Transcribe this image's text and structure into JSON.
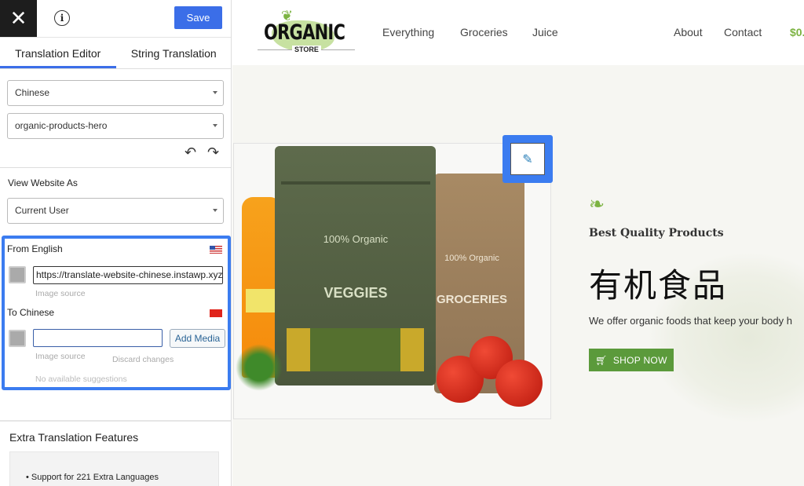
{
  "sidebar": {
    "close_icon": "close-icon",
    "info_icon": "info-icon",
    "info_glyph": "i",
    "save_label": "Save",
    "tabs": [
      {
        "label": "Translation Editor",
        "active": true
      },
      {
        "label": "String Translation",
        "active": false
      }
    ],
    "language_select": "Chinese",
    "string_select": "organic-products-hero",
    "view_as_label": "View Website As",
    "view_as_select": "Current User",
    "from_label": "From English",
    "from_value": "https://translate-website-chinese.instawp.xyz/w",
    "image_source_label": "Image source",
    "to_label": "To Chinese",
    "to_value": "",
    "add_media_label": "Add Media",
    "discard_label": "Discard changes",
    "suggestions_label": "No available suggestions",
    "extra_title": "Extra Translation Features",
    "extra_items": [
      "Support for 221 Extra Languages"
    ]
  },
  "site": {
    "logo_text": "ORGANIC",
    "logo_sub": "STORE",
    "nav": [
      "Everything",
      "Groceries",
      "Juice"
    ],
    "nav_right": [
      "About",
      "Contact"
    ],
    "cart_amount": "$0.",
    "hero_image_text": {
      "bag1_badge": "100% Organic",
      "bag1_label": "VEGGIES",
      "bag2_badge": "100% Organic",
      "bag2_label": "GROCERIES"
    },
    "tagline": "Best Quality Products",
    "heading": "有机食品",
    "paragraph": "We offer organic foods that keep your body h",
    "shop_label": "SHOP NOW",
    "colors": {
      "accent": "#3b7cf0",
      "green": "#5b9a3b",
      "save": "#3b6ee8"
    }
  }
}
